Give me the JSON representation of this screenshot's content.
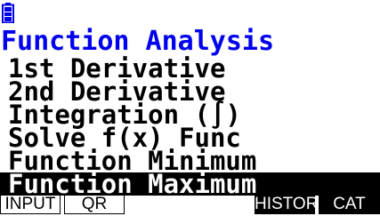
{
  "screen": {
    "title": "Function Analysis",
    "title_color": "#0000ee",
    "status_icon": "battery-icon",
    "items": [
      {
        "label": "1st Derivative",
        "selected": false
      },
      {
        "label": "2nd Derivative",
        "selected": false
      },
      {
        "label": "Integration (∫)",
        "selected": false
      },
      {
        "label": "Solve f(x) Func",
        "selected": false
      },
      {
        "label": "Function Minimum",
        "selected": false
      },
      {
        "label": "Function Maximum",
        "selected": true
      }
    ]
  },
  "fkeys": {
    "f1": "INPUT",
    "f2": "QR",
    "f5": "HISTORY",
    "f6": "CAT"
  }
}
